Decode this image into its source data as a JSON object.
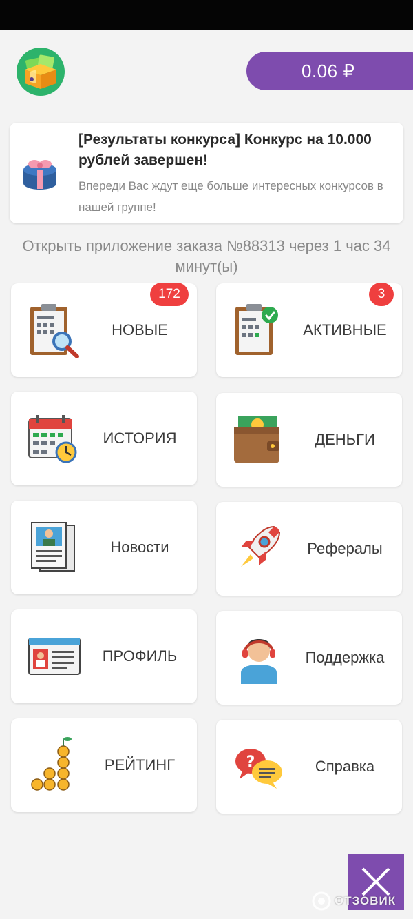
{
  "header": {
    "logo_icon": "gift-box-icon",
    "balance": "0.06 ₽"
  },
  "news": {
    "title": "[Результаты конкурса] Конкурс на 10.000 рублей завершен!",
    "text": "Впереди Вас ждут еще больше интересных конкурсов в нашей группе!",
    "image_icon": "gift-box-icon"
  },
  "order_timer": "Открыть приложение заказа №88313 через 1 час 34 минут(ы)",
  "menu": {
    "new": {
      "label": "НОВЫЕ",
      "badge": "172",
      "icon": "clipboard-search-icon"
    },
    "active": {
      "label": "АКТИВНЫЕ",
      "badge": "3",
      "icon": "clipboard-check-icon"
    },
    "history": {
      "label": "ИСТОРИЯ",
      "icon": "calendar-clock-icon"
    },
    "money": {
      "label": "ДЕНЬГИ",
      "icon": "wallet-icon"
    },
    "news": {
      "label": "Новости",
      "icon": "newspaper-icon"
    },
    "referrals": {
      "label": "Рефералы",
      "icon": "rocket-icon"
    },
    "profile": {
      "label": "ПРОФИЛЬ",
      "icon": "profile-card-icon"
    },
    "support": {
      "label": "Поддержка",
      "icon": "headset-operator-icon"
    },
    "rating": {
      "label": "РЕЙТИНГ",
      "icon": "coins-stack-icon"
    },
    "help": {
      "label": "Справка",
      "icon": "chat-bubbles-icon"
    }
  },
  "close_button_icon": "close-icon",
  "watermark": "ОТЗОВИК",
  "colors": {
    "accent": "#7e4cae",
    "badge": "#ef3f3f",
    "logo_bg": "#2db36b",
    "background": "#f3f3f3"
  }
}
